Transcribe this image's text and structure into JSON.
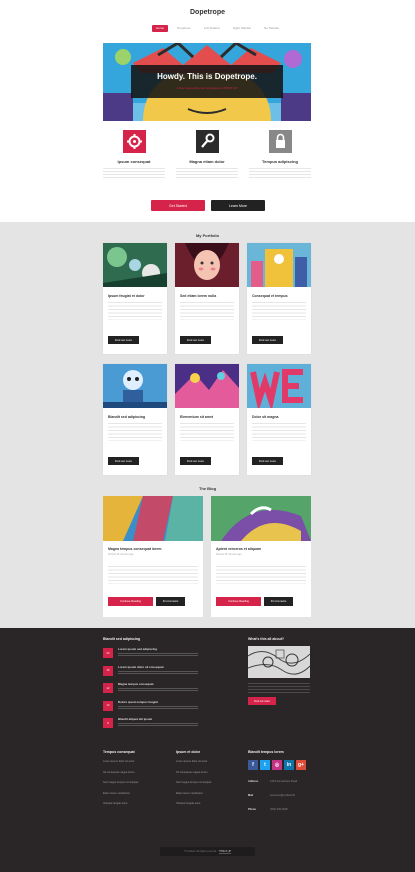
{
  "site": {
    "logo": "Dopetrope"
  },
  "nav": {
    "items": [
      "Home",
      "Dropdown",
      "Left Sidebar",
      "Right Sidebar",
      "No Sidebar"
    ]
  },
  "hero": {
    "title": "Howdy. This is Dopetrope.",
    "subtitle": "A free responsive site template by HTML5 UP"
  },
  "features": [
    {
      "title": "Ipsum consequat",
      "icon": "gear-icon"
    },
    {
      "title": "Magna etiam dolor",
      "icon": "wrench-icon"
    },
    {
      "title": "Tempus adipiscing",
      "icon": "lock-icon"
    }
  ],
  "cta": {
    "primary": "Get Started",
    "secondary": "Learn More"
  },
  "portfolio": {
    "heading": "My Portfolio",
    "items": [
      {
        "title": "Ipsum feugiat et dolor",
        "button": "Find out more"
      },
      {
        "title": "Sed etiam lorem nulla",
        "button": "Find out more"
      },
      {
        "title": "Consequat et tempus",
        "button": "Find out more"
      },
      {
        "title": "Blandit sed adipiscing",
        "button": "Find out more"
      },
      {
        "title": "Elementum sit amet",
        "button": "Find out more"
      },
      {
        "title": "Dolor sit magna",
        "button": "Find out more"
      }
    ]
  },
  "blog": {
    "heading": "The Blog",
    "posts": [
      {
        "title": "Magna tempus consequat lorem",
        "meta": "Posted 45 minutes ago",
        "read": "Continue Reading",
        "comments": "33 comments"
      },
      {
        "title": "Aptent veroeros et aliquam",
        "meta": "Posted 45 minutes ago",
        "read": "Continue Reading",
        "comments": "33 comments"
      }
    ]
  },
  "footer": {
    "news_heading": "Blandit sed adipiscing",
    "news": [
      {
        "day": "23",
        "title": "Lorem ipsum sed adipiscing"
      },
      {
        "day": "15",
        "title": "Lorem ipsum dolor sit consequat"
      },
      {
        "day": "12",
        "title": "Magna tempus consequat"
      },
      {
        "day": "10",
        "title": "Dolore ipsum tempus feugiat"
      },
      {
        "day": "8",
        "title": "Blandit aliquet elit ipsum"
      }
    ],
    "what_heading": "What's this all about?",
    "what_button": "Find out more",
    "col1_heading": "Tempus consequat",
    "col1": [
      "Lorem ipsum dolor sit amet",
      "Sit consequat magna lorem",
      "Sed magna tempus consequat",
      "Etiam lorem vestibulum",
      "Volutpat feugiat amet"
    ],
    "col2_heading": "Ipsum et dolor",
    "col2": [
      "Lorem ipsum dolor sit amet",
      "Sit consequat magna lorem",
      "Sed magna tempus consequat",
      "Etiam lorem vestibulum",
      "Volutpat feugiat amet"
    ],
    "social_heading": "Blandit tempus lorem",
    "social": [
      {
        "icon": "facebook-icon",
        "glyph": "f",
        "color": "#3b5998"
      },
      {
        "icon": "twitter-icon",
        "glyph": "t",
        "color": "#1da1f2"
      },
      {
        "icon": "instagram-icon",
        "glyph": "◎",
        "color": "#c13584"
      },
      {
        "icon": "linkedin-icon",
        "glyph": "in",
        "color": "#0e76a8"
      },
      {
        "icon": "googleplus-icon",
        "glyph": "g+",
        "color": "#dd4b39"
      }
    ],
    "contact": [
      {
        "label": "Address",
        "value": "1234 Somewhere Road"
      },
      {
        "label": "Mail",
        "value": "someone@untitled.tld"
      },
      {
        "label": "Phone",
        "value": "(000) 000-0000"
      }
    ],
    "copyright": "© Untitled. All rights reserved.",
    "design": "HTML5 UP"
  },
  "colors": {
    "accent": "#d52349",
    "dark": "#222222",
    "footer_bg": "#2a2627"
  }
}
